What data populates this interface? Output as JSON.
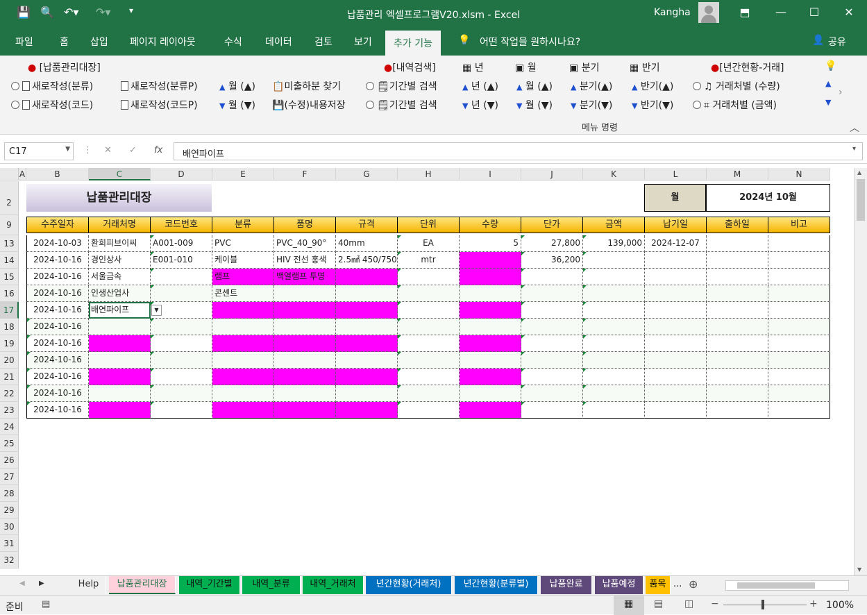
{
  "window": {
    "title": "납품관리 엑셀프로그램V20.xlsm  -  Excel",
    "user": "Kangha"
  },
  "ribbon_tabs": [
    "파일",
    "홈",
    "삽입",
    "페이지 레이아웃",
    "수식",
    "데이터",
    "검토",
    "보기",
    "추가 기능"
  ],
  "tell_me": "어떤 작업을 원하시나요?",
  "share": "공유",
  "ribbon": {
    "ledger": "[납품관리대장]",
    "new_cat": "새로작성(분류)",
    "new_code": "새로작성(코드)",
    "new_catP": "새로작성(분류P)",
    "new_codeP": "새로작성(코드P)",
    "month_up": "월 (▲)",
    "month_down": "월 (▼)",
    "unshipped": "미출하분 찾기",
    "save": "(수정)내용저장",
    "search": "[내역검색]",
    "period1": "기간별 검색",
    "period2": "기간별 검색",
    "year": "년",
    "month": "월",
    "quarter": "분기",
    "half": "반기",
    "year_up": "년 (▲)",
    "year_down": "년 (▼)",
    "mon_up": "월 (▲)",
    "mon_down": "월 (▼)",
    "q_up": "분기(▲)",
    "q_down": "분기(▼)",
    "h_up": "반기(▲)",
    "h_down": "반기(▼)",
    "annual": "[년간현황-거래]",
    "by_client_qty": "거래처별 (수량)",
    "by_client_amt": "거래처별 (금액)",
    "group_label": "메뉴 명령"
  },
  "formula": {
    "name_box": "C17",
    "fx": "fx",
    "content": "배연파이프"
  },
  "columns": [
    "A",
    "B",
    "C",
    "D",
    "E",
    "F",
    "G",
    "H",
    "I",
    "J",
    "K",
    "L",
    "M",
    "N"
  ],
  "rows": [
    "2",
    "9",
    "13",
    "14",
    "15",
    "16",
    "17",
    "18",
    "19",
    "20",
    "21",
    "22",
    "23",
    "24",
    "25",
    "26",
    "27",
    "28",
    "29",
    "30",
    "31",
    "32"
  ],
  "sheet": {
    "title": "납품관리대장",
    "month_label": "월",
    "month_value": "2024년 10월",
    "headers": [
      "수주일자",
      "거래처명",
      "코드번호",
      "분류",
      "품명",
      "규격",
      "단위",
      "수량",
      "단가",
      "금액",
      "납기일",
      "출하일",
      "비고"
    ],
    "data": [
      [
        "2024-10-03",
        "환희피브이씨",
        "A001-009",
        "PVC",
        "PVC_40_90°",
        "40mm",
        "EA",
        "5",
        "27,800",
        "139,000",
        "2024-12-07",
        "",
        ""
      ],
      [
        "2024-10-16",
        "경인상사",
        "E001-010",
        "케이블",
        "HIV  전선 홍색",
        "2.5㎟ 450/750V",
        "mtr",
        "",
        "36,200",
        "",
        "",
        "",
        ""
      ],
      [
        "2024-10-16",
        "서울금속",
        "",
        "램프",
        "백열램프 투명",
        "",
        "",
        "",
        "",
        "",
        "",
        "",
        ""
      ],
      [
        "2024-10-16",
        "인생산업사",
        "",
        "콘센트",
        "",
        "",
        "",
        "",
        "",
        "",
        "",
        "",
        ""
      ],
      [
        "2024-10-16",
        "배연파이프",
        "",
        "",
        "",
        "",
        "",
        "",
        "",
        "",
        "",
        "",
        ""
      ],
      [
        "2024-10-16",
        "",
        "",
        "",
        "",
        "",
        "",
        "",
        "",
        "",
        "",
        "",
        ""
      ],
      [
        "2024-10-16",
        "",
        "",
        "",
        "",
        "",
        "",
        "",
        "",
        "",
        "",
        "",
        ""
      ],
      [
        "2024-10-16",
        "",
        "",
        "",
        "",
        "",
        "",
        "",
        "",
        "",
        "",
        "",
        ""
      ],
      [
        "2024-10-16",
        "",
        "",
        "",
        "",
        "",
        "",
        "",
        "",
        "",
        "",
        "",
        ""
      ],
      [
        "2024-10-16",
        "",
        "",
        "",
        "",
        "",
        "",
        "",
        "",
        "",
        "",
        "",
        ""
      ],
      [
        "2024-10-16",
        "",
        "",
        "",
        "",
        "",
        "",
        "",
        "",
        "",
        "",
        "",
        ""
      ]
    ]
  },
  "sheet_tabs": [
    {
      "label": "Help",
      "color": "#f0f0f0",
      "text": "#333"
    },
    {
      "label": "납품관리대장",
      "color": "#ffd1dc",
      "text": "#217346"
    },
    {
      "label": "내역_기간별",
      "color": "#00b050",
      "text": "#111"
    },
    {
      "label": "내역_분류",
      "color": "#00b050",
      "text": "#111"
    },
    {
      "label": "내역_거래처",
      "color": "#00b050",
      "text": "#111"
    },
    {
      "label": "년간현황(거래처)",
      "color": "#0070c0",
      "text": "#fff"
    },
    {
      "label": "년간현황(분류별)",
      "color": "#0070c0",
      "text": "#fff"
    },
    {
      "label": "납품완료",
      "color": "#5f497a",
      "text": "#fff"
    },
    {
      "label": "납품예정",
      "color": "#5f497a",
      "text": "#fff"
    },
    {
      "label": "품목",
      "color": "#ffc000",
      "text": "#111"
    }
  ],
  "status": {
    "ready": "준비",
    "zoom": "100%"
  }
}
